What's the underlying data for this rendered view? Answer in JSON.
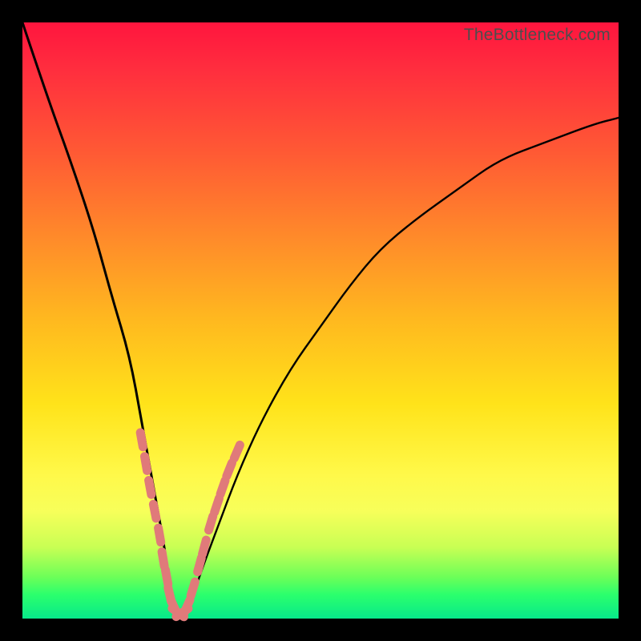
{
  "watermark": "TheBottleneck.com",
  "colors": {
    "frame": "#000000",
    "marker": "#e07a7a",
    "curve": "#000000",
    "gradient_top": "#ff153e",
    "gradient_bottom": "#07e98a"
  },
  "chart_data": {
    "type": "line",
    "title": "",
    "xlabel": "",
    "ylabel": "",
    "xlim": [
      0,
      100
    ],
    "ylim": [
      0,
      100
    ],
    "grid": false,
    "legend": false,
    "note": "Bottleneck-style V curve; y is bottleneck magnitude (0 = balanced at minimum). Values estimated from pixel positions.",
    "series": [
      {
        "name": "bottleneck-curve",
        "x": [
          0,
          4,
          8,
          12,
          15,
          18,
          20,
          22,
          24,
          25,
          26,
          28,
          30,
          33,
          36,
          40,
          45,
          50,
          55,
          60,
          66,
          73,
          80,
          88,
          96,
          100
        ],
        "y": [
          100,
          88,
          77,
          65,
          54,
          44,
          33,
          22,
          11,
          3,
          0,
          2,
          8,
          16,
          24,
          33,
          42,
          49,
          56,
          62,
          67,
          72,
          77,
          80,
          83,
          84
        ]
      }
    ],
    "markers": {
      "name": "highlighted-points",
      "points": [
        {
          "x": 20.0,
          "y": 30
        },
        {
          "x": 20.7,
          "y": 26
        },
        {
          "x": 21.4,
          "y": 22
        },
        {
          "x": 22.2,
          "y": 18
        },
        {
          "x": 23.0,
          "y": 14
        },
        {
          "x": 23.6,
          "y": 10
        },
        {
          "x": 24.2,
          "y": 7
        },
        {
          "x": 24.7,
          "y": 4
        },
        {
          "x": 25.4,
          "y": 2
        },
        {
          "x": 26.1,
          "y": 1
        },
        {
          "x": 26.8,
          "y": 1
        },
        {
          "x": 27.6,
          "y": 2
        },
        {
          "x": 28.6,
          "y": 5
        },
        {
          "x": 29.7,
          "y": 9
        },
        {
          "x": 30.5,
          "y": 12
        },
        {
          "x": 31.6,
          "y": 16
        },
        {
          "x": 32.6,
          "y": 19
        },
        {
          "x": 33.6,
          "y": 22
        },
        {
          "x": 34.7,
          "y": 25
        },
        {
          "x": 36.0,
          "y": 28
        }
      ]
    }
  }
}
